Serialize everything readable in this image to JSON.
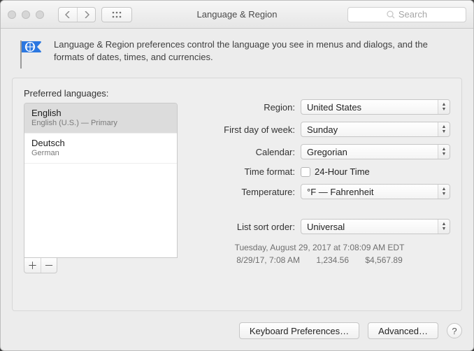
{
  "titlebar": {
    "title": "Language & Region",
    "search_placeholder": "Search"
  },
  "description": "Language & Region preferences control the language you see in menus and dialogs, and the formats of dates, times, and currencies.",
  "languages": {
    "label": "Preferred languages:",
    "items": [
      {
        "name": "English",
        "sub": "English (U.S.) — Primary",
        "selected": true
      },
      {
        "name": "Deutsch",
        "sub": "German",
        "selected": false
      }
    ]
  },
  "form": {
    "region": {
      "label": "Region:",
      "value": "United States"
    },
    "first_day": {
      "label": "First day of week:",
      "value": "Sunday"
    },
    "calendar": {
      "label": "Calendar:",
      "value": "Gregorian"
    },
    "time_format": {
      "label": "Time format:",
      "checkbox_label": "24-Hour Time",
      "checked": false
    },
    "temperature": {
      "label": "Temperature:",
      "value": "°F — Fahrenheit"
    },
    "list_sort": {
      "label": "List sort order:",
      "value": "Universal"
    }
  },
  "format_preview": {
    "line1": "Tuesday, August 29, 2017 at 7:08:09 AM EDT",
    "short_date": "8/29/17, 7:08 AM",
    "number": "1,234.56",
    "currency": "$4,567.89"
  },
  "footer": {
    "keyboard": "Keyboard Preferences…",
    "advanced": "Advanced…"
  }
}
